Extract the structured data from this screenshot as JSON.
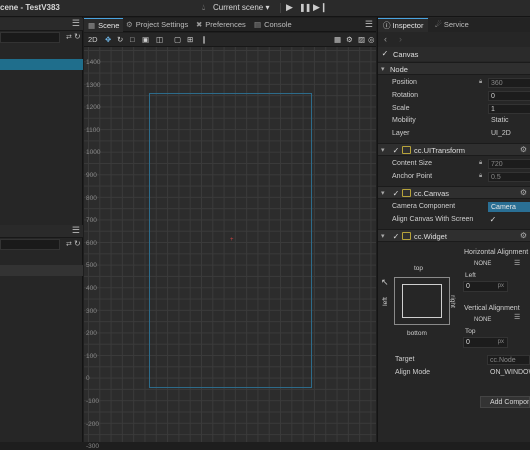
{
  "window": {
    "title": "cene - TestV383",
    "scene_select": "Current scene"
  },
  "left": {
    "top_row_icons": [
      "list-icon",
      "refresh-icon"
    ],
    "bottom_row_icons": [
      "list-icon",
      "refresh-icon"
    ]
  },
  "tabs": [
    {
      "label": "Scene",
      "icon": "scene-icon",
      "active": true
    },
    {
      "label": "Project Settings",
      "icon": "gear-icon"
    },
    {
      "label": "Preferences",
      "icon": "wrench-icon"
    },
    {
      "label": "Console",
      "icon": "console-icon"
    }
  ],
  "scene_toolbar": {
    "mode_2d": "2D"
  },
  "scene": {
    "ruler_labels": [
      "1400",
      "1300",
      "1200",
      "1100",
      "1000",
      "900",
      "800",
      "700",
      "600",
      "500",
      "400",
      "300",
      "200",
      "100",
      "0",
      "-100",
      "-200",
      "-300"
    ]
  },
  "inspector": {
    "tabs": [
      {
        "label": "Inspector",
        "icon": "info-icon"
      },
      {
        "label": "Service",
        "icon": "service-icon"
      }
    ],
    "node_name": "Canvas",
    "node_section": "Node",
    "node_props": [
      {
        "label": "Position",
        "value": "360",
        "dim": true,
        "locked": true
      },
      {
        "label": "Rotation",
        "value": "0"
      },
      {
        "label": "Scale",
        "value": "1"
      },
      {
        "label": "Mobility",
        "value": "Static"
      },
      {
        "label": "Layer",
        "value": "UI_2D"
      }
    ],
    "uitransform": {
      "title": "cc.UITransform",
      "props": [
        {
          "label": "Content Size",
          "value": "720",
          "locked": true
        },
        {
          "label": "Anchor Point",
          "value": "0.5",
          "locked": true
        }
      ]
    },
    "canvas": {
      "title": "cc.Canvas",
      "camera_label": "Camera Component",
      "camera_value": "Camera",
      "align_label": "Align Canvas With Screen"
    },
    "widget": {
      "title": "cc.Widget",
      "horizontal_alignment": "Horizontal Alignment",
      "h_none": "NONE",
      "left_label": "Left",
      "left_value": "0",
      "unit": "px",
      "vertical_alignment": "Vertical Alignment",
      "v_none": "NONE",
      "top_label": "Top",
      "top_value": "0",
      "box_top": "top",
      "box_bottom": "bottom",
      "box_left": "left",
      "box_right": "right",
      "target_label": "Target",
      "target_value": "cc.Node",
      "align_mode_label": "Align Mode",
      "align_mode_value": "ON_WINDOW"
    },
    "add_component": "Add Component"
  }
}
